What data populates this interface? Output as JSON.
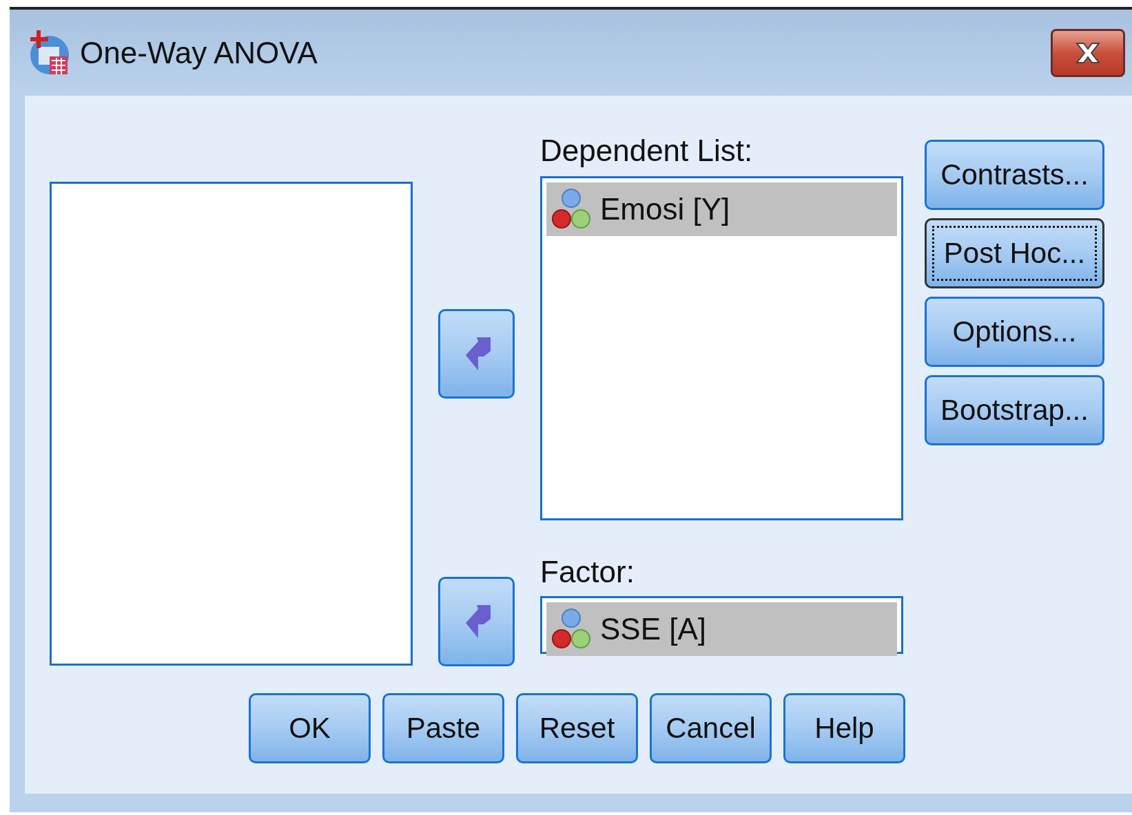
{
  "window": {
    "title": "One-Way ANOVA"
  },
  "dependent_list": {
    "label": "Dependent List:",
    "items": [
      {
        "name": "Emosi [Y]",
        "selected": true
      }
    ]
  },
  "factor": {
    "label": "Factor:",
    "items": [
      {
        "name": "SSE [A]",
        "selected": true
      }
    ]
  },
  "side_buttons": [
    {
      "label": "Contrasts...",
      "focused": false
    },
    {
      "label": "Post Hoc...",
      "focused": true
    },
    {
      "label": "Options...",
      "focused": false
    },
    {
      "label": "Bootstrap...",
      "focused": false
    }
  ],
  "buttons": [
    {
      "label": "OK"
    },
    {
      "label": "Paste"
    },
    {
      "label": "Reset"
    },
    {
      "label": "Cancel"
    },
    {
      "label": "Help"
    }
  ]
}
